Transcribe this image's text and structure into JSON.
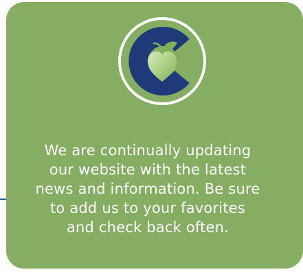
{
  "card": {
    "message_lines": [
      "We are continually updating",
      "our website with the latest",
      "news and information. Be sure",
      "to add us to your favorites",
      "and check back often."
    ]
  },
  "colors": {
    "card_background": "#85ae63",
    "logo_ring": "#ffffff",
    "logo_letter": "#1f3a78",
    "logo_heart": "#b5d48f",
    "text": "#ffffff"
  },
  "icons": {
    "logo": "c-with-apple-heart-logo"
  }
}
